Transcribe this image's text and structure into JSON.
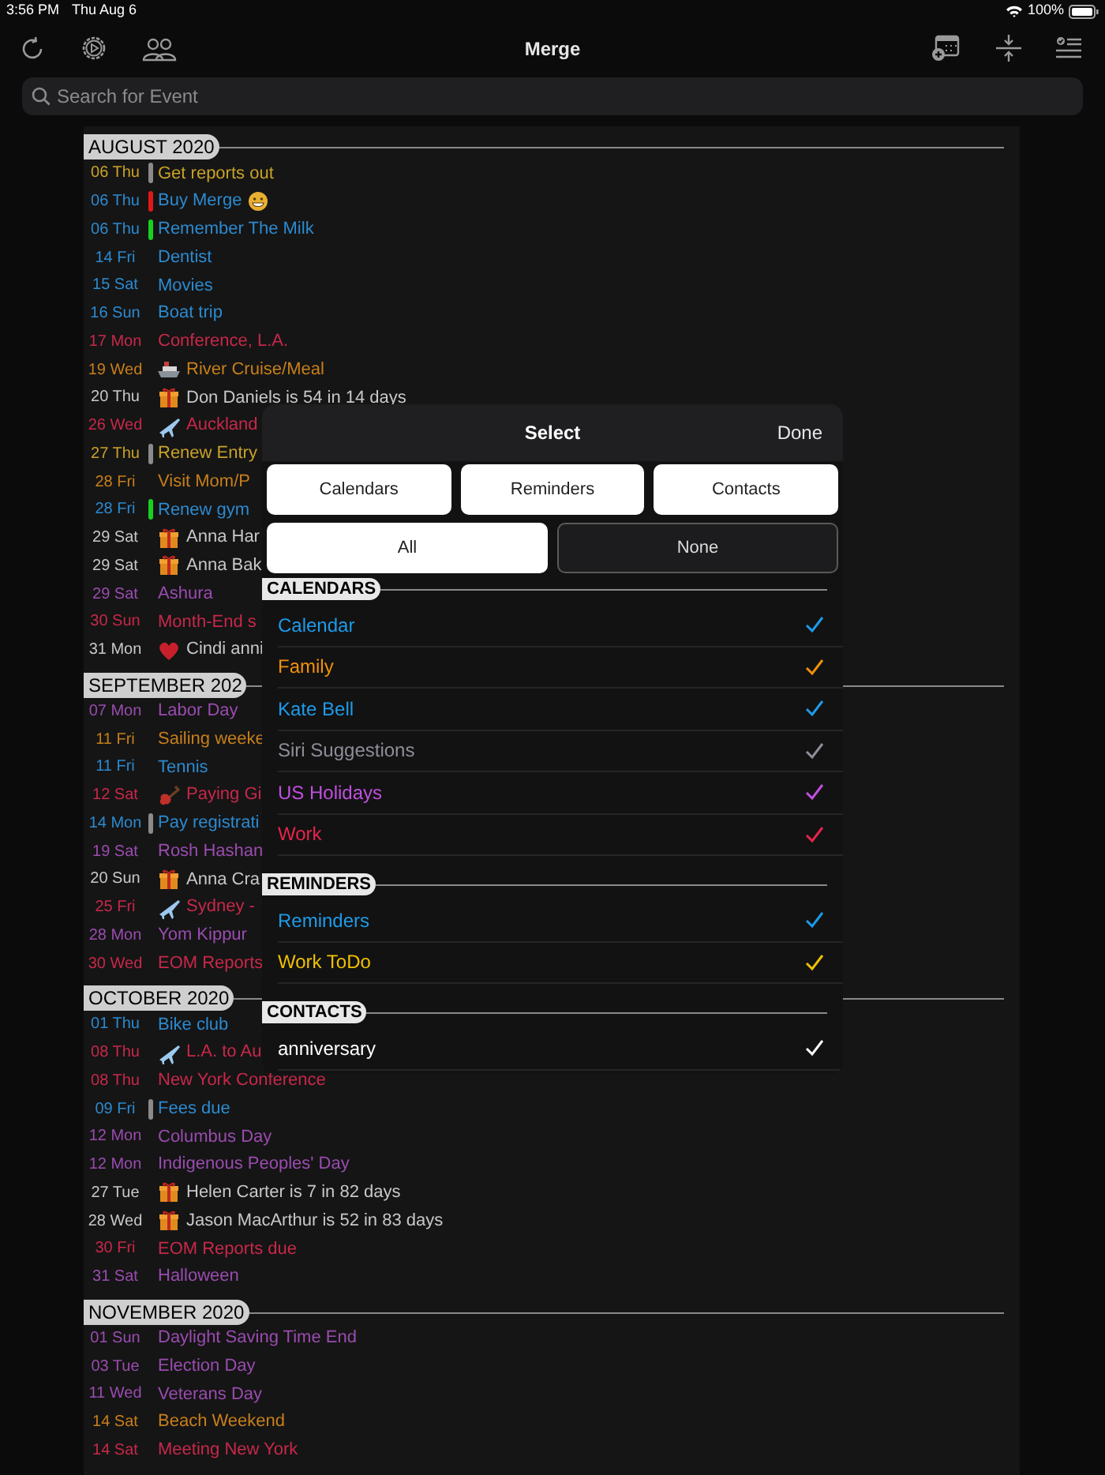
{
  "status_bar": {
    "time": "3:56 PM",
    "date": "Thu Aug 6",
    "battery": "100%"
  },
  "toolbar": {
    "title": "Merge"
  },
  "search": {
    "placeholder": "Search for Event"
  },
  "months": [
    {
      "title": "AUGUST 2020",
      "events": [
        {
          "date": "06 Thu",
          "title": "Get reports out",
          "color": "#c9a227",
          "bar": {
            "color": "#8a8a8a"
          }
        },
        {
          "date": "06 Thu",
          "title": "Buy Merge",
          "color": "#2c8ad0",
          "bar": {
            "color": "#e01818"
          },
          "kind": "grin"
        },
        {
          "date": "06 Thu",
          "title": "Remember The Milk",
          "color": "#2c8ad0",
          "bar": {
            "color": "#18d020"
          }
        },
        {
          "date": "14 Fri",
          "title": "Dentist",
          "color": "#2c8ad0"
        },
        {
          "date": "15 Sat",
          "title": "Movies",
          "color": "#2c8ad0"
        },
        {
          "date": "16 Sun",
          "title": "Boat trip",
          "color": "#2c8ad0"
        },
        {
          "date": "17 Mon",
          "title": "Conference, L.A.",
          "color": "#c8284a"
        },
        {
          "date": "19 Wed",
          "title": "River Cruise/Meal",
          "color": "#c87f1a",
          "kind": "cruise"
        },
        {
          "date": "20 Thu",
          "title": "Don Daniels is 54 in 14 days",
          "color": "#c8c8c8",
          "kind": "birthday"
        },
        {
          "date": "26 Wed",
          "title": "Auckland",
          "color": "#c8284a",
          "kind": "flight"
        },
        {
          "date": "27 Thu",
          "title": "Renew Entry",
          "color": "#c9a227",
          "bar": {
            "color": "#8a8a8a"
          }
        },
        {
          "date": "28 Fri",
          "title": "Visit Mom/P",
          "color": "#c87f1a"
        },
        {
          "date": "28 Fri",
          "title": "Renew gym",
          "color": "#2c8ad0",
          "bar": {
            "color": "#18d020"
          }
        },
        {
          "date": "29 Sat",
          "title": "Anna Har",
          "color": "#c8c8c8",
          "kind": "birthday"
        },
        {
          "date": "29 Sat",
          "title": "Anna Bak",
          "color": "#c8c8c8",
          "kind": "birthday"
        },
        {
          "date": "29 Sat",
          "title": "Ashura",
          "color": "#9a4cb0"
        },
        {
          "date": "30 Sun",
          "title": "Month-End s",
          "color": "#c8284a"
        },
        {
          "date": "31 Mon",
          "title": "Cindi anni",
          "color": "#c8c8c8",
          "kind": "anniversary"
        }
      ]
    },
    {
      "title": "SEPTEMBER 202",
      "events": [
        {
          "date": "07 Mon",
          "title": "Labor Day",
          "color": "#9a4cb0"
        },
        {
          "date": "11 Fri",
          "title": "Sailing weeke",
          "color": "#c87f1a"
        },
        {
          "date": "11 Fri",
          "title": "Tennis",
          "color": "#2c8ad0"
        },
        {
          "date": "12 Sat",
          "title": "Paying Gi",
          "color": "#c8284a",
          "kind": "gig"
        },
        {
          "date": "14 Mon",
          "title": "Pay registrati",
          "color": "#2c8ad0",
          "bar": {
            "color": "#8a8a8a"
          }
        },
        {
          "date": "19 Sat",
          "title": "Rosh Hashan",
          "color": "#9a4cb0"
        },
        {
          "date": "20 Sun",
          "title": "Anna Cra",
          "color": "#c8c8c8",
          "kind": "birthday"
        },
        {
          "date": "25 Fri",
          "title": "Sydney -",
          "color": "#c8284a",
          "kind": "flight"
        },
        {
          "date": "28 Mon",
          "title": "Yom Kippur",
          "color": "#9a4cb0"
        },
        {
          "date": "30 Wed",
          "title": "EOM Reports",
          "color": "#c8284a"
        }
      ]
    },
    {
      "title": "OCTOBER 2020",
      "events": [
        {
          "date": "01 Thu",
          "title": "Bike club",
          "color": "#2c8ad0"
        },
        {
          "date": "08 Thu",
          "title": "L.A. to Au",
          "color": "#c8284a",
          "kind": "flight"
        },
        {
          "date": "08 Thu",
          "title": "New York Conference",
          "color": "#c8284a"
        },
        {
          "date": "09 Fri",
          "title": "Fees due",
          "color": "#2c8ad0",
          "bar": {
            "color": "#8a8a8a"
          }
        },
        {
          "date": "12 Mon",
          "title": "Columbus Day",
          "color": "#9a4cb0"
        },
        {
          "date": "12 Mon",
          "title": "Indigenous Peoples' Day",
          "color": "#9a4cb0"
        },
        {
          "date": "27 Tue",
          "title": "Helen Carter is 7 in 82 days",
          "color": "#c8c8c8",
          "kind": "birthday"
        },
        {
          "date": "28 Wed",
          "title": "Jason MacArthur is 52 in 83 days",
          "color": "#c8c8c8",
          "kind": "birthday"
        },
        {
          "date": "30 Fri",
          "title": "EOM Reports due",
          "color": "#c8284a"
        },
        {
          "date": "31 Sat",
          "title": "Halloween",
          "color": "#9a4cb0"
        }
      ]
    },
    {
      "title": "NOVEMBER 2020",
      "events": [
        {
          "date": "01 Sun",
          "title": "Daylight Saving Time End",
          "color": "#9a4cb0"
        },
        {
          "date": "03 Tue",
          "title": "Election Day",
          "color": "#9a4cb0"
        },
        {
          "date": "11 Wed",
          "title": "Veterans Day",
          "color": "#9a4cb0"
        },
        {
          "date": "14 Sat",
          "title": "Beach Weekend",
          "color": "#c87f1a"
        },
        {
          "date": "14 Sat",
          "title": "Meeting New York",
          "color": "#c8284a"
        }
      ]
    }
  ],
  "popup": {
    "title": "Select",
    "done": "Done",
    "source_buttons": [
      "Calendars",
      "Reminders",
      "Contacts"
    ],
    "selection_buttons": [
      {
        "label": "All",
        "selected": true
      },
      {
        "label": "None",
        "selected": false
      }
    ],
    "sections": [
      {
        "title": "CALENDARS",
        "items": [
          {
            "label": "Calendar",
            "color": "#1e9be9",
            "checked": true
          },
          {
            "label": "Family",
            "color": "#f0900a",
            "checked": true
          },
          {
            "label": "Kate Bell",
            "color": "#1e9be9",
            "checked": true
          },
          {
            "label": "Siri Suggestions",
            "color": "#8e8e99",
            "checked": true
          },
          {
            "label": "US Holidays",
            "color": "#c050e0",
            "checked": true
          },
          {
            "label": "Work",
            "color": "#e8244c",
            "checked": true
          }
        ]
      },
      {
        "title": "REMINDERS",
        "items": [
          {
            "label": "Reminders",
            "color": "#1e9be9",
            "checked": true
          },
          {
            "label": "Work ToDo",
            "color": "#f0c000",
            "checked": true
          }
        ]
      },
      {
        "title": "CONTACTS",
        "items": [
          {
            "label": "anniversary",
            "color": "#ffffff",
            "checked": true
          }
        ]
      }
    ]
  }
}
